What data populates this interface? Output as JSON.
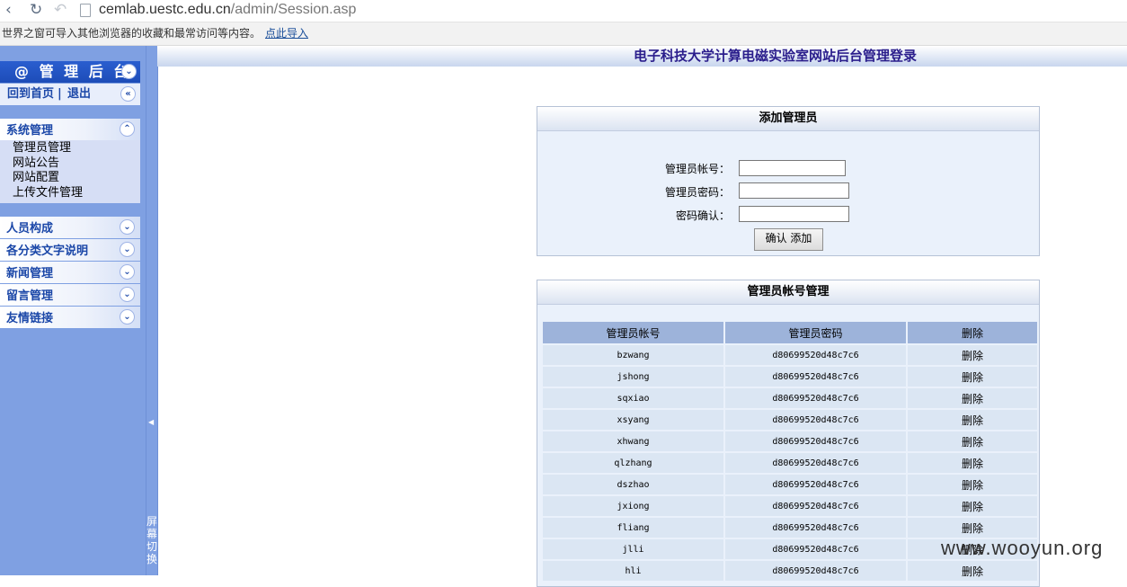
{
  "browser": {
    "url_host": "cemlab.uestc.edu.cn",
    "url_path": "/admin/Session.asp",
    "infobar_message": "世界之窗可导入其他浏览器的收藏和最常访问等内容。",
    "infobar_link": "点此导入"
  },
  "sidebar": {
    "title": "@ 管 理 后 台",
    "home_link": "回到首页",
    "separator": "|",
    "logout_link": "退出",
    "sections": [
      {
        "label": "系统管理",
        "expanded": true,
        "items": [
          "管理员管理",
          "网站公告",
          "网站配置",
          "上传文件管理"
        ]
      },
      {
        "label": "人员构成",
        "expanded": false
      },
      {
        "label": "各分类文字说明",
        "expanded": false
      },
      {
        "label": "新闻管理",
        "expanded": false
      },
      {
        "label": "留言管理",
        "expanded": false
      },
      {
        "label": "友情链接",
        "expanded": false
      }
    ],
    "splitter_label": "屏幕切换"
  },
  "main": {
    "title": "电子科技大学计算电磁实验室网站后台管理登录",
    "add_panel": {
      "title": "添加管理员",
      "fields": [
        {
          "label": "管理员帐号：",
          "value": ""
        },
        {
          "label": "管理员密码：",
          "value": ""
        },
        {
          "label": "密码确认：",
          "value": ""
        }
      ],
      "submit_label": "确认 添加"
    },
    "accounts_panel": {
      "title": "管理员帐号管理",
      "columns": [
        "管理员帐号",
        "管理员密码",
        "删除"
      ],
      "rows": [
        {
          "account": "bzwang",
          "password": "d80699520d48c7c6",
          "action": "删除"
        },
        {
          "account": "jshong",
          "password": "d80699520d48c7c6",
          "action": "删除"
        },
        {
          "account": "sqxiao",
          "password": "d80699520d48c7c6",
          "action": "删除"
        },
        {
          "account": "xsyang",
          "password": "d80699520d48c7c6",
          "action": "删除"
        },
        {
          "account": "xhwang",
          "password": "d80699520d48c7c6",
          "action": "删除"
        },
        {
          "account": "qlzhang",
          "password": "d80699520d48c7c6",
          "action": "删除"
        },
        {
          "account": "dszhao",
          "password": "d80699520d48c7c6",
          "action": "删除"
        },
        {
          "account": "jxiong",
          "password": "d80699520d48c7c6",
          "action": "删除"
        },
        {
          "account": "fliang",
          "password": "d80699520d48c7c6",
          "action": "删除"
        },
        {
          "account": "jlli",
          "password": "d80699520d48c7c6",
          "action": "删除"
        },
        {
          "account": "hli",
          "password": "d80699520d48c7c6",
          "action": "删除"
        }
      ]
    }
  },
  "watermark": "www.wooyun.org"
}
